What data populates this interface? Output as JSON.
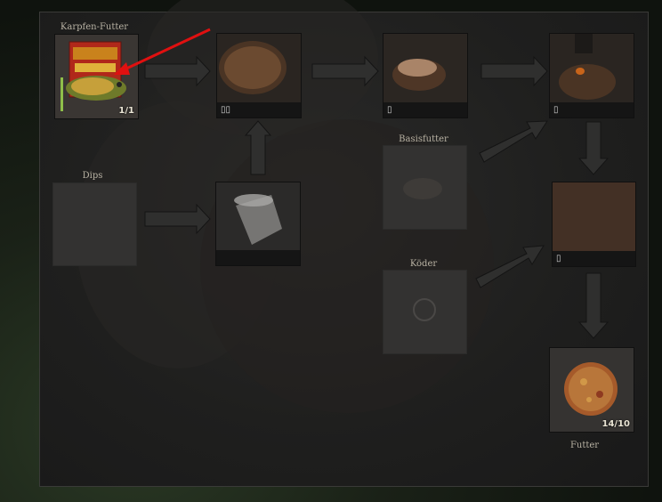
{
  "labels": {
    "carp_feed": "Karpfen-Futter",
    "dips": "Dips",
    "base_feed": "Basisfutter",
    "bait": "Köder",
    "feed": "Futter"
  },
  "slots": {
    "carp_feed_count": "1/1",
    "bowl_1_bar": "▯▯",
    "hands_bar": "▯",
    "bowl_2_bar": "▯",
    "mix_bar": "▯",
    "result_count": "14/10"
  },
  "colors": {
    "panel_bg": "#1f1f1e",
    "arrow_fill": "#2f2f2e",
    "annotation_arrow": "#e01010",
    "progress_green": "#8fbf4a"
  },
  "icons": {
    "carp_feed": "carp-feed-bag-icon",
    "bowl": "feed-bowl-icon",
    "hands": "kneading-hands-icon",
    "bowl_with_liquid": "bowl-liquid-icon",
    "cup": "plastic-cup-icon",
    "mix": "feed-mix-icon",
    "base_feed": "base-feed-pile-icon",
    "bait": "bait-icon",
    "result": "feed-ball-icon"
  }
}
